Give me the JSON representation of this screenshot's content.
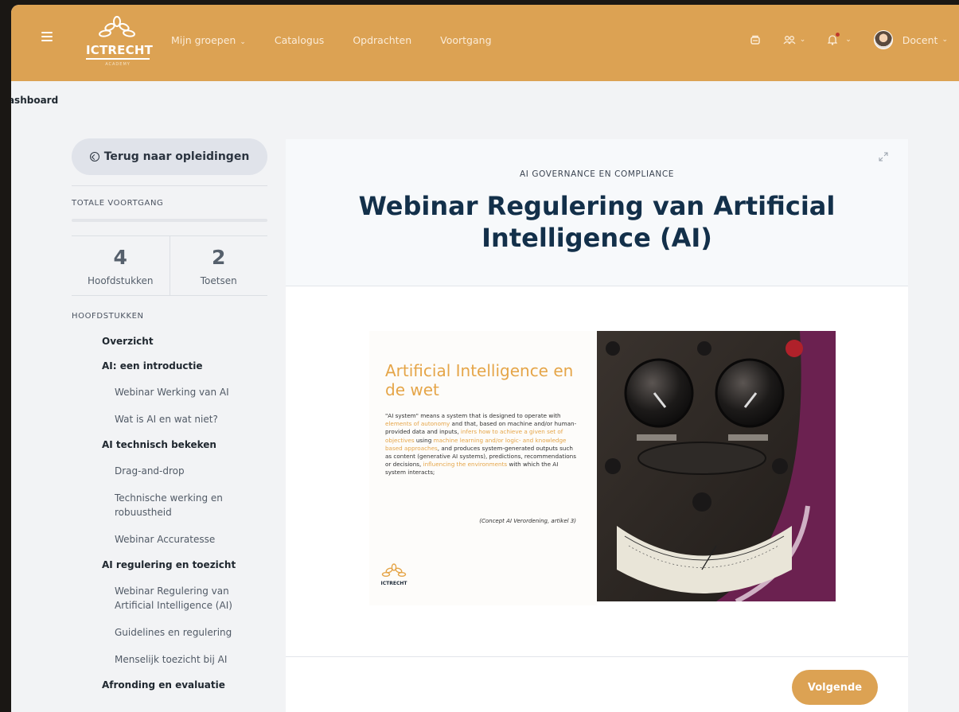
{
  "header": {
    "logo_text": "ICTRECHT",
    "logo_sub": "ACADEMY",
    "nav": [
      {
        "label": "Mijn groepen",
        "has_dropdown": true
      },
      {
        "label": "Catalogus",
        "has_dropdown": false
      },
      {
        "label": "Opdrachten",
        "has_dropdown": false
      },
      {
        "label": "Voortgang",
        "has_dropdown": false
      }
    ],
    "user_label": "Docent",
    "accent_color": "#dca253"
  },
  "breadcrumb": "Dashboard",
  "sidebar": {
    "back_label": "Terug naar opleidingen",
    "progress_label": "TOTALE VOORTGANG",
    "progress_value": 0,
    "stats": [
      {
        "value": "4",
        "label": "Hoofdstukken"
      },
      {
        "value": "2",
        "label": "Toetsen"
      }
    ],
    "chapters_label": "HOOFDSTUKKEN",
    "items": [
      {
        "type": "chapter",
        "label": "Overzicht"
      },
      {
        "type": "chapter",
        "label": "AI: een introductie"
      },
      {
        "type": "lesson",
        "label": "Webinar Werking van AI"
      },
      {
        "type": "lesson",
        "label": "Wat is AI en wat niet?"
      },
      {
        "type": "chapter",
        "label": "AI technisch bekeken"
      },
      {
        "type": "lesson",
        "label": "Drag-and-drop"
      },
      {
        "type": "lesson",
        "label": "Technische werking en robuustheid"
      },
      {
        "type": "lesson",
        "label": "Webinar Accuratesse"
      },
      {
        "type": "chapter",
        "label": "AI regulering en toezicht"
      },
      {
        "type": "lesson",
        "label": "Webinar Regulering van Artificial Intelligence (AI)"
      },
      {
        "type": "lesson",
        "label": "Guidelines en regulering"
      },
      {
        "type": "lesson",
        "label": "Menselijk toezicht bij AI"
      },
      {
        "type": "chapter",
        "label": "Afronding en evaluatie"
      }
    ]
  },
  "content": {
    "eyebrow": "AI GOVERNANCE EN COMPLIANCE",
    "title": "Webinar Regulering van Artificial Intelligence (AI)",
    "slide": {
      "title": "Artificial Intelligence en de wet",
      "quote_parts": [
        {
          "text": "\"AI system\" means a system that is designed to operate with ",
          "hl": false
        },
        {
          "text": "elements of autonomy",
          "hl": true
        },
        {
          "text": " and that, based on machine and/or human-provided data and inputs, ",
          "hl": false
        },
        {
          "text": "infers how to achieve a given set of objectives",
          "hl": true
        },
        {
          "text": " using ",
          "hl": false
        },
        {
          "text": "machine learning and/or logic- and knowledge based approaches",
          "hl": true
        },
        {
          "text": ", and produces system-generated outputs such as content (generative AI systems), predictions, recommendations or decisions, ",
          "hl": false
        },
        {
          "text": "influencing the environments",
          "hl": true
        },
        {
          "text": " with which the AI system interacts;",
          "hl": false
        }
      ],
      "citation": "(Concept AI Verordening, artikel 3)",
      "logo_text": "ICTRECHT"
    },
    "next_label": "Volgende"
  }
}
